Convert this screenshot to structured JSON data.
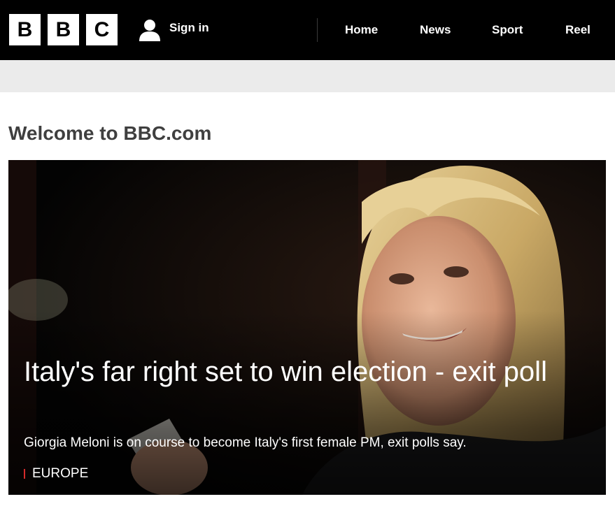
{
  "header": {
    "logo_letters": [
      "B",
      "B",
      "C"
    ],
    "signin_label": "Sign in",
    "signin_icon": "user-icon",
    "nav": [
      "Home",
      "News",
      "Sport",
      "Reel"
    ]
  },
  "page": {
    "welcome": "Welcome to BBC.com"
  },
  "hero": {
    "headline": "Italy's far right set to win election - exit poll",
    "summary": "Giorgia Meloni is on course to become Italy's first female PM, exit polls say.",
    "tag": "EUROPE",
    "tag_color": "#d52a2a"
  },
  "colors": {
    "header_bg": "#000000",
    "subbar_bg": "#ebebeb",
    "welcome_text": "#3f3f3f"
  }
}
